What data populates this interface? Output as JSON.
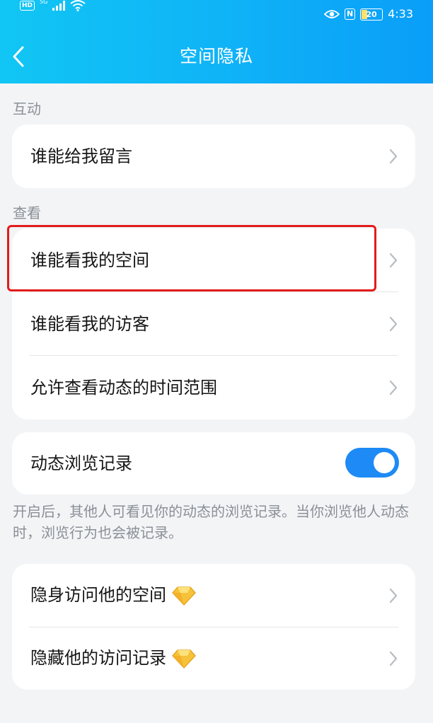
{
  "status_bar": {
    "hd": "HD",
    "signal_label": "5G",
    "time": "4:33",
    "battery": "20",
    "nfc": "N"
  },
  "header": {
    "title": "空间隐私",
    "back_icon": "chevron-left-icon"
  },
  "sections": {
    "interaction_label": "互动",
    "view_label": "查看"
  },
  "rows": {
    "who_can_message": "谁能给我留言",
    "who_can_view_space": "谁能看我的空间",
    "who_can_view_visitors": "谁能看我的访客",
    "allow_view_time_range": "允许查看动态的时间范围",
    "feed_browse_record": "动态浏览记录",
    "invisible_visit": "隐身访问他的空间",
    "hide_visit_record": "隐藏他的访问记录"
  },
  "toggle": {
    "feed_browse_record_on": true,
    "on_color": "#1e8af5"
  },
  "note": "开启后，其他人可看见你的动态的浏览记录。当你浏览他人动态时，浏览行为也会被记录。",
  "icons": {
    "vip_icon": "diamond-icon",
    "chevron": "chevron-right-icon"
  },
  "colors": {
    "header_start": "#11c6f4",
    "header_end": "#0a9ef8",
    "highlight": "#e31b1b"
  }
}
